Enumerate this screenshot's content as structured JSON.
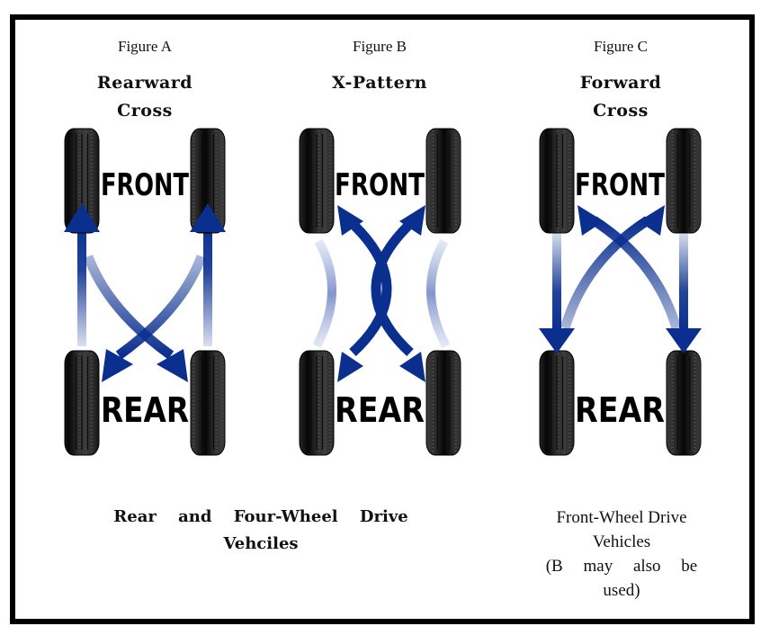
{
  "figures": [
    {
      "label": "Figure A",
      "title_line1": "Rearward",
      "title_line2": "Cross",
      "front_label": "FRONT",
      "rear_label": "REAR",
      "pattern": "rearward-cross"
    },
    {
      "label": "Figure B",
      "title_line1": "X-Pattern",
      "title_line2": "",
      "front_label": "FRONT",
      "rear_label": "REAR",
      "pattern": "x-pattern"
    },
    {
      "label": "Figure C",
      "title_line1": "Forward",
      "title_line2": "Cross",
      "front_label": "FRONT",
      "rear_label": "REAR",
      "pattern": "forward-cross"
    }
  ],
  "captions": {
    "rear_4wd_line1": "Rear and Four-Wheel Drive",
    "rear_4wd_line2": "Vehciles",
    "fwd_line1": "Front-Wheel Drive",
    "fwd_line2": "Vehicles",
    "fwd_line3": "(B may also be",
    "fwd_line4": "used)"
  },
  "colors": {
    "arrow": "#0a2f8f",
    "arrow_light": "#7d93cc",
    "tire": "#111111",
    "border": "#000000"
  }
}
